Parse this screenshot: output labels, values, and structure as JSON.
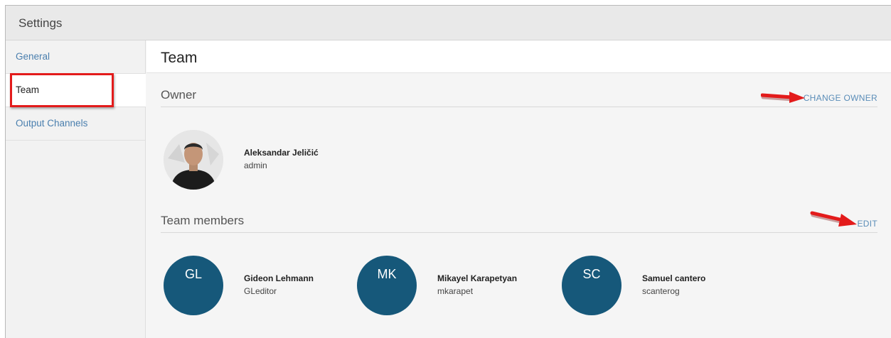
{
  "window": {
    "title": "Settings"
  },
  "sidebar": {
    "items": [
      {
        "label": "General",
        "active": false
      },
      {
        "label": "Team",
        "active": true
      },
      {
        "label": "Output Channels",
        "active": false
      }
    ]
  },
  "main": {
    "title": "Team",
    "owner_section": {
      "title": "Owner",
      "action_label": "CHANGE OWNER",
      "owner": {
        "name": "Aleksandar Jeličić",
        "username": "admin"
      }
    },
    "members_section": {
      "title": "Team members",
      "action_label": "EDIT",
      "members": [
        {
          "initials": "GL",
          "name": "Gideon Lehmann",
          "username": "GLeditor"
        },
        {
          "initials": "MK",
          "name": "Mikayel Karapetyan",
          "username": "mkarapet"
        },
        {
          "initials": "SC",
          "name": "Samuel cantero",
          "username": "scanterog"
        }
      ]
    }
  },
  "colors": {
    "avatar_bg": "#16587a",
    "link": "#5a8db8",
    "highlight": "#e31b1b"
  }
}
